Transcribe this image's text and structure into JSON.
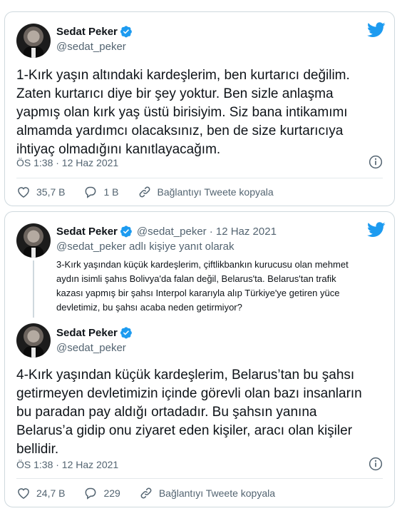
{
  "tweet1": {
    "author_name": "Sedat Peker",
    "author_handle": "@sedat_peker",
    "text_lines": [
      "1-Kırk yaşın altındaki kardeşlerim, ben kurtarıcı değilim.",
      "Zaten kurtarıcı diye bir şey yoktur. Ben sizle anlaşma",
      "yapmış olan kırk yaş üstü birisiyim. Siz bana intikamımı",
      "almamda yardımcı olacaksınız, ben de size kurtarıcıya",
      "ihtiyaç olmadığını kanıtlayacağım."
    ],
    "timestamp": "ÖS 1:38 · 12 Haz 2021",
    "likes": "35,7 B",
    "replies": "1 B",
    "copy_link": "Bağlantıyı Tweete kopyala"
  },
  "tweet2": {
    "quoted": {
      "author_name": "Sedat Peker",
      "author_handle": "@sedat_peker",
      "date": "· 12 Haz 2021",
      "reply_to": "@sedat_peker adlı kişiye yanıt olarak",
      "text_lines": [
        "3-Kırk yaşından küçük kardeşlerim, çiftlikbankın kurucusu olan mehmet",
        "aydın isimli şahıs Bolivya'da falan değil, Belarus'ta. Belarus'tan trafik",
        "kazası yapmış bir şahsı Interpol kararıyla alıp Türkiye'ye getiren yüce",
        "devletimiz, bu şahsı acaba neden getirmiyor?"
      ]
    },
    "author_name": "Sedat Peker",
    "author_handle": "@sedat_peker",
    "text_lines": [
      "4-Kırk yaşından küçük kardeşlerim, Belarus’tan bu şahsı",
      "getirmeyen devletimizin içinde görevli olan bazı insanların",
      "bu paradan pay aldığı ortadadır. Bu şahsın yanına",
      "Belarus’a gidip onu ziyaret eden kişiler, aracı olan kişiler",
      "bellidir."
    ],
    "timestamp": "ÖS 1:38 · 12 Haz 2021",
    "likes": "24,7 B",
    "replies": "229",
    "copy_link": "Bağlantıyı Tweete kopyala"
  },
  "colors": {
    "twitter_blue": "#1d9bf0",
    "text": "#0f1419",
    "muted": "#536471",
    "border": "#cfd9de"
  },
  "icons": [
    "twitter-bird-icon",
    "verified-badge-icon",
    "info-icon",
    "heart-icon",
    "reply-icon",
    "link-icon"
  ]
}
